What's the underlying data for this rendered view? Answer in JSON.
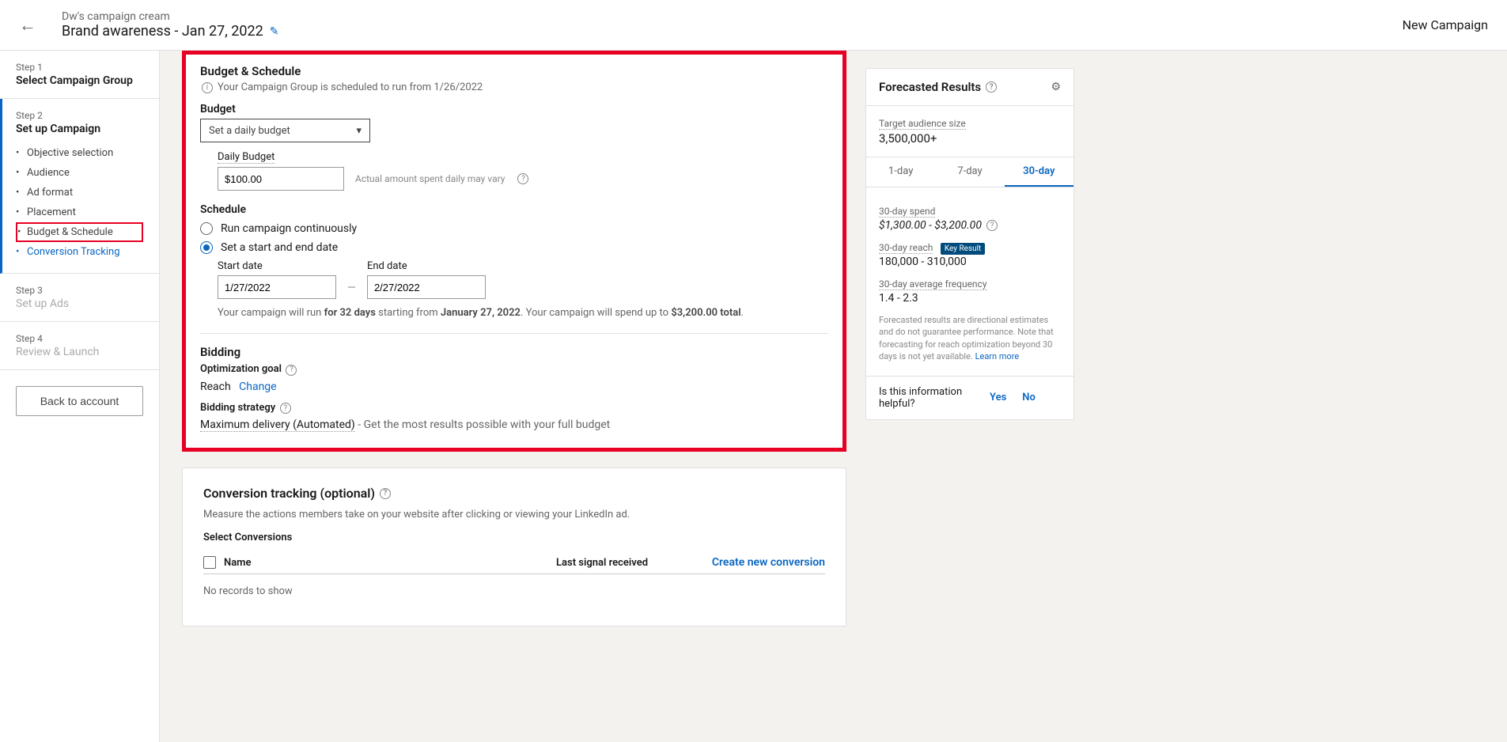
{
  "header": {
    "breadcrumb": "Dw's campaign cream",
    "title": "Brand awareness - Jan 27, 2022",
    "new_campaign": "New Campaign"
  },
  "sidebar": {
    "step1_label": "Step 1",
    "step1_title": "Select Campaign Group",
    "step2_label": "Step 2",
    "step2_title": "Set up Campaign",
    "substeps": [
      {
        "label": "Objective selection"
      },
      {
        "label": "Audience"
      },
      {
        "label": "Ad format"
      },
      {
        "label": "Placement"
      },
      {
        "label": "Budget & Schedule",
        "highlighted": true
      },
      {
        "label": "Conversion Tracking",
        "link": true
      }
    ],
    "step3_label": "Step 3",
    "step3_title": "Set up Ads",
    "step4_label": "Step 4",
    "step4_title": "Review & Launch",
    "back_btn": "Back to account"
  },
  "budget": {
    "section_title": "Budget & Schedule",
    "info": "Your Campaign Group is scheduled to run from 1/26/2022",
    "budget_label": "Budget",
    "budget_select": "Set a daily budget",
    "daily_budget_label": "Daily Budget",
    "daily_budget_value": "$100.00",
    "daily_budget_help": "Actual amount spent daily may vary",
    "schedule_label": "Schedule",
    "radio_continuous": "Run campaign continuously",
    "radio_dates": "Set a start and end date",
    "start_label": "Start date",
    "start_value": "1/27/2022",
    "end_label": "End date",
    "end_value": "2/27/2022",
    "run_prefix": "Your campaign will run",
    "run_days": "for 32 days",
    "run_starting": "starting from",
    "run_startdate": "January 27, 2022",
    "run_spend": ". Your campaign will spend up to",
    "run_amount": "$3,200.00 total",
    "run_period": "."
  },
  "bidding": {
    "title": "Bidding",
    "optgoal_label": "Optimization goal",
    "optgoal_value": "Reach",
    "change": "Change",
    "strategy_label": "Bidding strategy",
    "strategy_value": "Maximum delivery (Automated)",
    "strategy_desc": " - Get the most results possible with your full budget"
  },
  "conversion": {
    "title": "Conversion tracking (optional)",
    "desc": "Measure the actions members take on your website after clicking or viewing your LinkedIn ad.",
    "select_label": "Select Conversions",
    "col_name": "Name",
    "col_signal": "Last signal received",
    "create_link": "Create new conversion",
    "empty": "No records to show"
  },
  "forecast": {
    "title": "Forecasted Results",
    "audience_label": "Target audience size",
    "audience_value": "3,500,000+",
    "tabs": [
      "1-day",
      "7-day",
      "30-day"
    ],
    "spend_label": "30-day spend",
    "spend_value": "$1,300.00 - $3,200.00",
    "reach_label": "30-day reach",
    "key_badge": "Key Result",
    "reach_value": "180,000 - 310,000",
    "freq_label": "30-day average frequency",
    "freq_value": "1.4 - 2.3",
    "disclaimer": "Forecasted results are directional estimates and do not guarantee performance. Note that forecasting for reach optimization beyond 30 days is not yet available.",
    "learn": "Learn more",
    "helpful_q": "Is this information helpful?",
    "yes": "Yes",
    "no": "No"
  }
}
